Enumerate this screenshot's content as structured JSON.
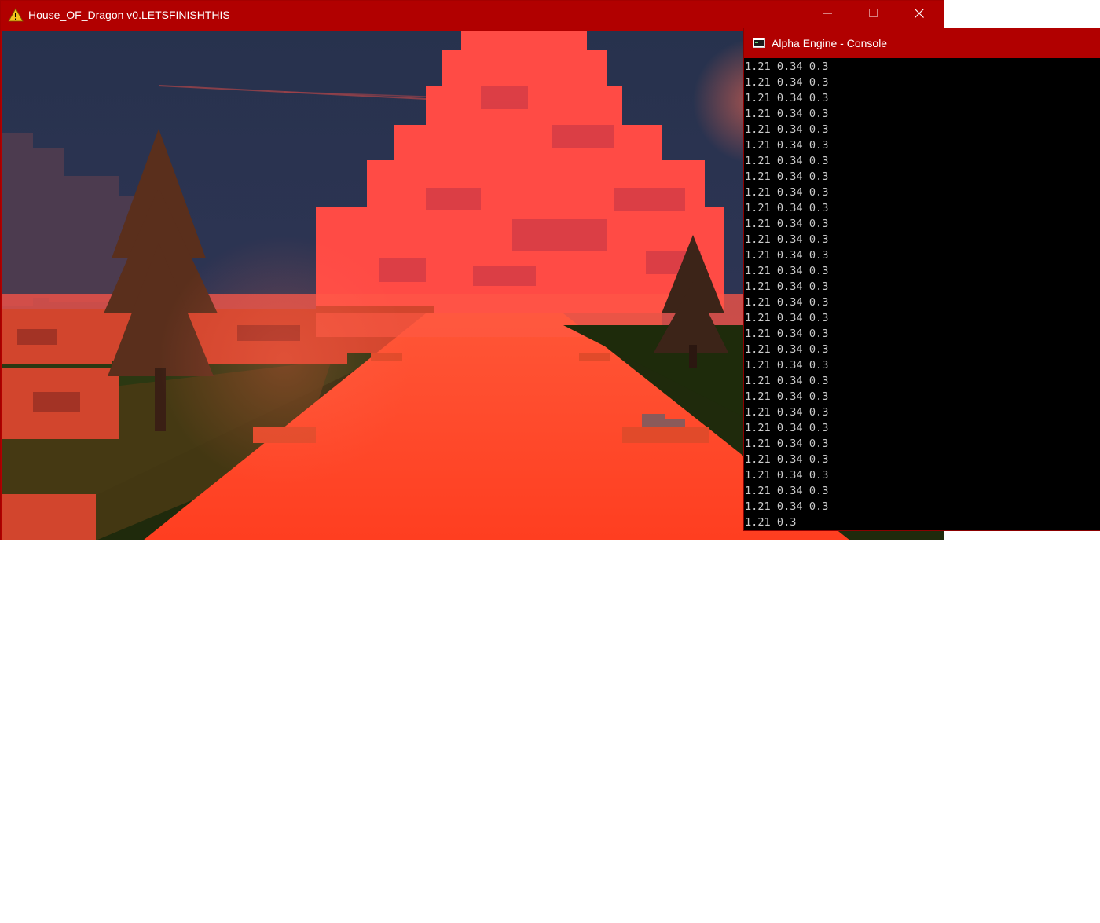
{
  "game_window": {
    "title": "House_OF_Dragon v0.LETSFINISHTHIS",
    "title_icon": "warning-icon",
    "controls": [
      "minimize-icon",
      "maximize-icon",
      "close-icon"
    ],
    "accent_color": "#b10000"
  },
  "console_window": {
    "title": "Alpha Engine - Console",
    "icon": "console-icon",
    "lines": [
      "1.21 0.34 0.3",
      "1.21 0.34 0.3",
      "1.21 0.34 0.3",
      "1.21 0.34 0.3",
      "1.21 0.34 0.3",
      "1.21 0.34 0.3",
      "1.21 0.34 0.3",
      "1.21 0.34 0.3",
      "1.21 0.34 0.3",
      "1.21 0.34 0.3",
      "1.21 0.34 0.3",
      "1.21 0.34 0.3",
      "1.21 0.34 0.3",
      "1.21 0.34 0.3",
      "1.21 0.34 0.3",
      "1.21 0.34 0.3",
      "1.21 0.34 0.3",
      "1.21 0.34 0.3",
      "1.21 0.34 0.3",
      "1.21 0.34 0.3",
      "1.21 0.34 0.3",
      "1.21 0.34 0.3",
      "1.21 0.34 0.3",
      "1.21 0.34 0.3",
      "1.21 0.34 0.3",
      "1.21 0.34 0.3",
      "1.21 0.34 0.3",
      "1.21 0.34 0.3",
      "1.21 0.34 0.3",
      "1.21 0.3"
    ]
  }
}
